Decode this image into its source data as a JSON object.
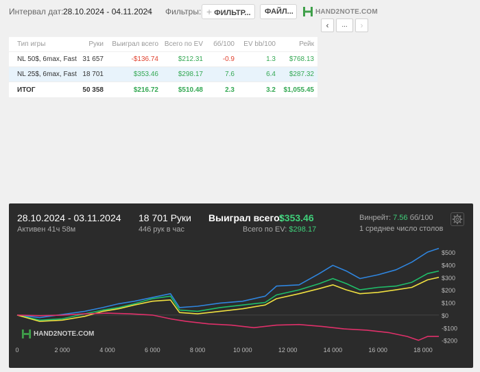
{
  "topbar": {
    "date_label": "Интервал дат:",
    "date_value": "28.10.2024 - 04.11.2024",
    "filters_label": "Фильтры:",
    "filter_button": "ФИЛЬТР...",
    "files_button": "ФАЙЛ...",
    "logo_text": "HAND2NOTE.COM",
    "nav_prev": "‹",
    "nav_more": "...",
    "nav_next": "›"
  },
  "stats": {
    "headers": [
      "Тип игры",
      "Руки",
      "Выиграл всего",
      "Всего по EV",
      "бб/100",
      "EV bb/100",
      "Рейк"
    ],
    "rows": [
      [
        "NL 50$, 6max, Fast",
        "31 657",
        "-$136.74",
        "$212.31",
        "-0.9",
        "1.3",
        "$768.13"
      ],
      [
        "NL 25$, 6max, Fast",
        "18 701",
        "$353.46",
        "$298.17",
        "7.6",
        "6.4",
        "$287.32"
      ]
    ],
    "total": [
      "ИТОГ",
      "50 358",
      "$216.72",
      "$510.48",
      "2.3",
      "3.2",
      "$1,055.45"
    ]
  },
  "panel": {
    "date_range": "28.10.2024 - 03.11.2024",
    "active": "Активен 41ч 58м",
    "hands": "18 701 Руки",
    "hands_per_hour": "446 рук в час",
    "won_label": "Выиграл всего:",
    "won_value": "$353.46",
    "ev_label": "Всего по EV:",
    "ev_value": "$298.17",
    "winrate_label": "Винрейт:",
    "winrate_value": "7.56",
    "winrate_unit": "бб/100",
    "tables": "1 среднее число столов",
    "watermark": "HAND2NOTE.COM"
  },
  "chart_data": {
    "type": "line",
    "x_ticks": [
      0,
      2000,
      4000,
      6000,
      8000,
      10000,
      12000,
      14000,
      16000,
      18000
    ],
    "x_tick_labels": [
      "0",
      "2 000",
      "4 000",
      "6 000",
      "8 000",
      "10 000",
      "12 000",
      "14 000",
      "16 000",
      "18 000"
    ],
    "y_ticks": [
      -200,
      -100,
      0,
      100,
      200,
      300,
      400,
      500
    ],
    "y_tick_labels": [
      "-$200",
      "-$100",
      "$0",
      "$100",
      "$200",
      "$300",
      "$400",
      "$500"
    ],
    "xlim": [
      0,
      18701
    ],
    "ylim": [
      -240,
      560
    ],
    "colors": {
      "blue": "#2f86e0",
      "green": "#1fbf6a",
      "yellow": "#f0e040",
      "red": "#e0306a"
    },
    "series": [
      {
        "color": "blue",
        "x": [
          0,
          1000,
          2000,
          3000,
          3800,
          4500,
          5200,
          6000,
          6800,
          7200,
          8000,
          9000,
          10000,
          11000,
          11500,
          12500,
          13400,
          14000,
          14600,
          15200,
          16000,
          16800,
          17500,
          18200,
          18701
        ],
        "y": [
          0,
          -20,
          5,
          30,
          60,
          90,
          110,
          140,
          170,
          60,
          70,
          95,
          110,
          150,
          230,
          240,
          330,
          395,
          350,
          290,
          320,
          360,
          420,
          500,
          530
        ]
      },
      {
        "color": "green",
        "x": [
          0,
          1000,
          2000,
          3000,
          3800,
          4500,
          5200,
          6000,
          6800,
          7200,
          8000,
          9000,
          10000,
          11000,
          11500,
          12500,
          13400,
          14000,
          14600,
          15200,
          16000,
          16800,
          17500,
          18200,
          18701
        ],
        "y": [
          0,
          -40,
          -30,
          10,
          40,
          60,
          90,
          130,
          150,
          40,
          30,
          60,
          80,
          100,
          160,
          200,
          250,
          290,
          250,
          200,
          220,
          230,
          260,
          330,
          350
        ]
      },
      {
        "color": "yellow",
        "x": [
          0,
          1000,
          2000,
          3000,
          3800,
          4500,
          5200,
          6000,
          6800,
          7200,
          8000,
          9000,
          10000,
          11000,
          11500,
          12500,
          13400,
          14000,
          14600,
          15200,
          16000,
          16800,
          17500,
          18200,
          18701
        ],
        "y": [
          0,
          -50,
          -40,
          -10,
          30,
          50,
          80,
          110,
          120,
          20,
          10,
          30,
          50,
          80,
          130,
          170,
          210,
          240,
          200,
          170,
          180,
          200,
          220,
          280,
          300
        ]
      },
      {
        "color": "red",
        "x": [
          0,
          1000,
          2000,
          3000,
          4000,
          5000,
          6000,
          6800,
          7500,
          8500,
          9500,
          10500,
          11500,
          12500,
          13500,
          14500,
          15500,
          16500,
          17300,
          17800,
          18200,
          18701
        ],
        "y": [
          0,
          -5,
          0,
          10,
          15,
          10,
          0,
          -30,
          -50,
          -70,
          -80,
          -100,
          -80,
          -75,
          -90,
          -110,
          -120,
          -140,
          -170,
          -200,
          -170,
          -170
        ]
      }
    ]
  }
}
